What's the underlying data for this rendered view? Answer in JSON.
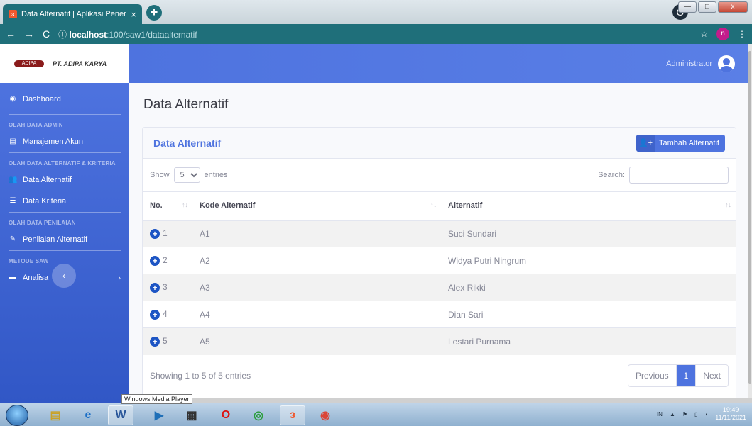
{
  "browser": {
    "tab_title": "Data Alternatif | Aplikasi Penerim",
    "tab_close": "×",
    "new_tab": "+",
    "url_host": "localhost",
    "url_path": ":100/saw1/dataalternatif",
    "profile_initial": "n",
    "win_min": "—",
    "win_max": "□",
    "win_close": "x"
  },
  "brand": {
    "logo_text": "ADIPA",
    "name": "PT. ADIPA KARYA"
  },
  "sidebar": {
    "dashboard": "Dashboard",
    "heading_admin": "OLAH DATA ADMIN",
    "manajemen_akun": "Manajemen Akun",
    "heading_alt": "OLAH DATA ALTERNATIF & KRITERIA",
    "data_alternatif": "Data Alternatif",
    "data_kriteria": "Data Kriteria",
    "heading_penilaian": "OLAH DATA PENILAIAN",
    "penilaian_alternatif": "Penilaian Alternatif",
    "heading_saw": "METODE SAW",
    "analisa": "Analisa",
    "toggle": "‹"
  },
  "topbar": {
    "user_name": "Administrator"
  },
  "page": {
    "title": "Data Alternatif"
  },
  "card": {
    "header": "Data Alternatif",
    "add_button": "Tambah Alternatif",
    "show_label": "Show",
    "show_value": "5",
    "entries_label": "entries",
    "search_label": "Search:",
    "columns": [
      "No.",
      "Kode Alternatif",
      "Alternatif"
    ],
    "rows": [
      {
        "no": "1",
        "kode": "A1",
        "nama": "Suci Sundari"
      },
      {
        "no": "2",
        "kode": "A2",
        "nama": "Widya Putri Ningrum"
      },
      {
        "no": "3",
        "kode": "A3",
        "nama": "Alex Rikki"
      },
      {
        "no": "4",
        "kode": "A4",
        "nama": "Dian Sari"
      },
      {
        "no": "5",
        "kode": "A5",
        "nama": "Lestari Purnama"
      }
    ],
    "info": "Showing 1 to 5 of 5 entries",
    "prev": "Previous",
    "page": "1",
    "next": "Next"
  },
  "taskbar": {
    "tooltip": "Windows Media Player",
    "tray_lang": "IN",
    "time": "19:49",
    "date": "11/11/2021"
  },
  "colors": {
    "primary": "#4e73df",
    "chrome": "#1f6f7a"
  }
}
